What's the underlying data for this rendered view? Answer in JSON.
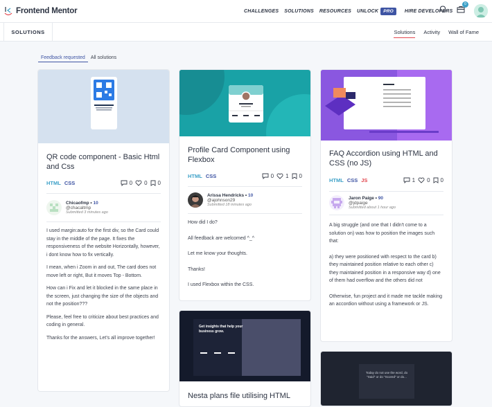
{
  "header": {
    "logo_text": "Frontend Mentor",
    "nav": [
      "CHALLENGES",
      "SOLUTIONS",
      "RESOURCES",
      "UNLOCK"
    ],
    "pro_badge": "PRO",
    "hire": "HIRE DEVELOPERS",
    "cart_count": "0"
  },
  "subheader": {
    "title": "SOLUTIONS",
    "tabs": [
      "Solutions",
      "Activity",
      "Wall of Fame"
    ]
  },
  "filters": [
    "Feedback requested",
    "All solutions"
  ],
  "cards": [
    {
      "title": "QR code component - Basic Html and Css",
      "tags": [
        "HTML",
        "CSS"
      ],
      "comments": "0",
      "likes": "0",
      "bookmarks": "0",
      "author": "Chicaofmp",
      "score": "10",
      "handle": "@chacaltmp",
      "time": "Submitted 3 minutes ago",
      "paragraphs": [
        "I used margin:auto for the first div, so the Card could stay in the middle of the page. It fixes the responsiveness of the website Horizontally, however, i dont know how to fix vertically.",
        "I mean, when i Zoom in and out, The card does not move left or right, But it moves Top - Bottom.",
        "How can i Fix and let it blocked in the same place in the screen, just changing the size of the objects and not the position???",
        "Please, feel free to criticize about best practices and coding in general.",
        "Thanks for the answers, Let's all improve together!"
      ]
    },
    {
      "title": "Profile Card Component using Flexbox",
      "tags": [
        "HTML",
        "CSS"
      ],
      "comments": "0",
      "likes": "1",
      "bookmarks": "0",
      "author": "Arissa Hendricks",
      "score": "10",
      "handle": "@ajohnson29",
      "time": "Submitted 18 minutes ago",
      "paragraphs": [
        "How did I do?",
        "All feedback are welcomed ^_^",
        "Let me know your thoughts.",
        "Thanks!",
        "I used Flexbox within the CSS."
      ]
    },
    {
      "title": "FAQ Accordion using HTML and CSS (no JS)",
      "tags": [
        "HTML",
        "CSS",
        "JS"
      ],
      "comments": "1",
      "likes": "0",
      "bookmarks": "0",
      "author": "Jaron Paige",
      "score": "90",
      "handle": "@jdpaige",
      "time": "Submitted about 1 hour ago",
      "paragraphs": [
        "A big struggle (and one that I didn't come to a solution on) was how to position the images such that:",
        "a) they were positioned with respect to the card b) they maintained position relative to each other c) they maintained position in a responsive way d) one of them had overflow and the others did not",
        "Otherwise, fun project and it made me tackle making an accordion without using a framework or JS."
      ]
    },
    {
      "title": "Nesta plans file utilising HTML",
      "thumb_text": "Get insights that help your business grow."
    },
    {
      "thumb_text": "Today do not use the word, do \"Said\" or do \"Scored\" or do..."
    }
  ],
  "colors": {
    "html": "#3ea1c8",
    "css": "#3e54a3",
    "js": "#e3474f",
    "accent": "#3e54a3"
  }
}
